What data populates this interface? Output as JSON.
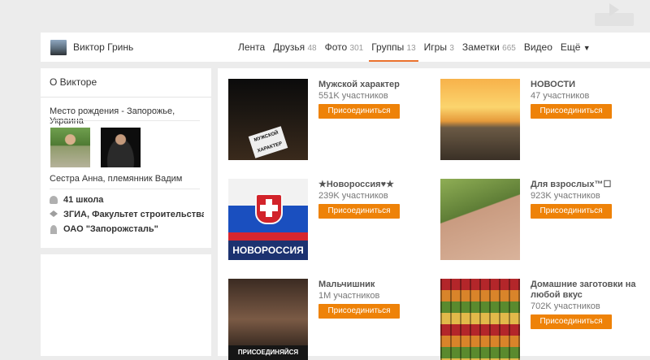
{
  "profile": {
    "name": "Виктор Гринь"
  },
  "nav": {
    "tabs": [
      {
        "label": "Лента",
        "count": ""
      },
      {
        "label": "Друзья",
        "count": "48"
      },
      {
        "label": "Фото",
        "count": "301"
      },
      {
        "label": "Группы",
        "count": "13",
        "active": true
      },
      {
        "label": "Игры",
        "count": "3"
      },
      {
        "label": "Заметки",
        "count": "665"
      },
      {
        "label": "Видео",
        "count": ""
      },
      {
        "label": "Ещё",
        "count": ""
      }
    ],
    "more_caret": "▼"
  },
  "about": {
    "title": "О Викторе",
    "birthplace": "Место рождения - Запорожье, Украина",
    "relatives_caption": "Сестра Анна, племянник Вадим",
    "school": "41 школа",
    "education": "ЗГИА, Факультет строительства и...",
    "work": "ОАО \"Запорожсталь\""
  },
  "groups": [
    {
      "name": "Мужской характер",
      "members": "551K участников",
      "join": "Присоединиться",
      "thumb_text": "МУЖСКОЙ ХАРАКТЕР"
    },
    {
      "name": "НОВОСТИ",
      "members": "47 участников",
      "join": "Присоединиться",
      "thumb_text": ""
    },
    {
      "name": "★Новороссия♥★",
      "members": "239K участников",
      "join": "Присоединиться",
      "thumb_text": "НОВОРОССИЯ"
    },
    {
      "name": "Для взрослых™☐",
      "members": "923K участников",
      "join": "Присоединиться",
      "thumb_text": ""
    },
    {
      "name": "Мальчишник",
      "members": "1M участников",
      "join": "Присоединиться",
      "thumb_text": "ПРИСОЕДИНЯЙСЯ"
    },
    {
      "name": "Домашние заготовки на любой вкус",
      "members": "702K участников",
      "join": "Присоединиться",
      "thumb_text": ""
    }
  ]
}
